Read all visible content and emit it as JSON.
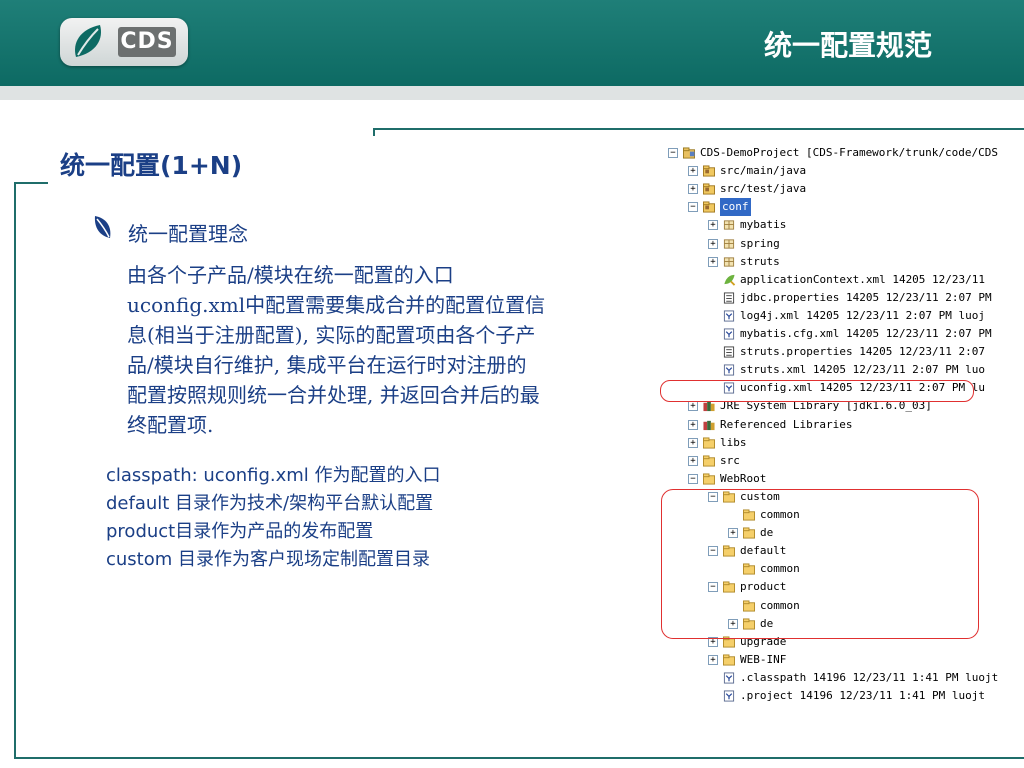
{
  "header": {
    "logo_text": "CDS",
    "title": "统一配置规范"
  },
  "colors": {
    "header_bg": "#0d6a63",
    "text_blue": "#1b3f86",
    "highlight_red": "#e03030",
    "selection_blue": "#3169c6"
  },
  "slide": {
    "section_title": "统一配置(1+N)",
    "concept": "统一配置理念",
    "paragraph_lines": [
      "由各个子产品/模块在统一配置的入口",
      "uconfig.xml中配置需要集成合并的配置位置信",
      "息(相当于注册配置), 实际的配置项由各个子产",
      "品/模块自行维护, 集成平台在运行时对注册的",
      "配置按照规则统一合并处理, 并返回合并后的最",
      "终配置项."
    ],
    "list": [
      "classpath: uconfig.xml 作为配置的入口",
      "default 目录作为技术/架构平台默认配置",
      "product目录作为产品的发布配置",
      "custom 目录作为客户现场定制配置目录"
    ]
  },
  "tree": {
    "items": [
      {
        "label": "CDS-DemoProject [CDS-Framework/trunk/code/CDS-",
        "toggle": "−",
        "icon": "project-icon"
      },
      {
        "label": "src/main/java",
        "toggle": "+",
        "icon": "source-folder-icon"
      },
      {
        "label": "src/test/java",
        "toggle": "+",
        "icon": "source-folder-icon"
      },
      {
        "label": "conf",
        "toggle": "−",
        "icon": "source-folder-icon",
        "selected": true
      },
      {
        "label": "mybatis",
        "toggle": "+",
        "icon": "package-icon"
      },
      {
        "label": "spring",
        "toggle": "+",
        "icon": "package-icon"
      },
      {
        "label": "struts",
        "toggle": "+",
        "icon": "package-icon"
      },
      {
        "label": "applicationContext.xml 14205  12/23/11",
        "toggle": "",
        "icon": "spring-file-icon"
      },
      {
        "label": "jdbc.properties 14205  12/23/11 2:07 PM",
        "toggle": "",
        "icon": "properties-file-icon"
      },
      {
        "label": "log4j.xml 14205  12/23/11 2:07 PM  luoj",
        "toggle": "",
        "icon": "xml-file-icon"
      },
      {
        "label": "mybatis.cfg.xml 14205  12/23/11 2:07 PM",
        "toggle": "",
        "icon": "xml-file-icon"
      },
      {
        "label": "struts.properties 14205  12/23/11 2:07",
        "toggle": "",
        "icon": "properties-file-icon"
      },
      {
        "label": "struts.xml 14205  12/23/11 2:07 PM  luo",
        "toggle": "",
        "icon": "xml-file-icon"
      },
      {
        "label": "uconfig.xml 14205  12/23/11 2:07 PM  lu",
        "toggle": "",
        "icon": "xml-file-icon"
      },
      {
        "label": "JRE System Library [jdk1.6.0_03]",
        "toggle": "+",
        "icon": "library-icon"
      },
      {
        "label": "Referenced Libraries",
        "toggle": "+",
        "icon": "library-icon"
      },
      {
        "label": "libs",
        "toggle": "+",
        "icon": "folder-icon"
      },
      {
        "label": "src",
        "toggle": "+",
        "icon": "folder-icon"
      },
      {
        "label": "WebRoot",
        "toggle": "−",
        "icon": "folder-icon"
      },
      {
        "label": "custom",
        "toggle": "−",
        "icon": "folder-icon"
      },
      {
        "label": "common",
        "toggle": "",
        "icon": "folder-icon"
      },
      {
        "label": "de",
        "toggle": "+",
        "icon": "folder-icon"
      },
      {
        "label": "default",
        "toggle": "−",
        "icon": "folder-icon"
      },
      {
        "label": "common",
        "toggle": "",
        "icon": "folder-icon"
      },
      {
        "label": "product",
        "toggle": "−",
        "icon": "folder-icon"
      },
      {
        "label": "common",
        "toggle": "",
        "icon": "folder-icon"
      },
      {
        "label": "de",
        "toggle": "+",
        "icon": "folder-icon"
      },
      {
        "label": "upgrade",
        "toggle": "+",
        "icon": "folder-icon"
      },
      {
        "label": "WEB-INF",
        "toggle": "+",
        "icon": "folder-icon"
      },
      {
        "label": ".classpath 14196  12/23/11 1:41 PM  luojt",
        "toggle": "",
        "icon": "xml-file-icon"
      },
      {
        "label": ".project 14196  12/23/11 1:41 PM  luojt",
        "toggle": "",
        "icon": "xml-file-icon"
      }
    ]
  }
}
